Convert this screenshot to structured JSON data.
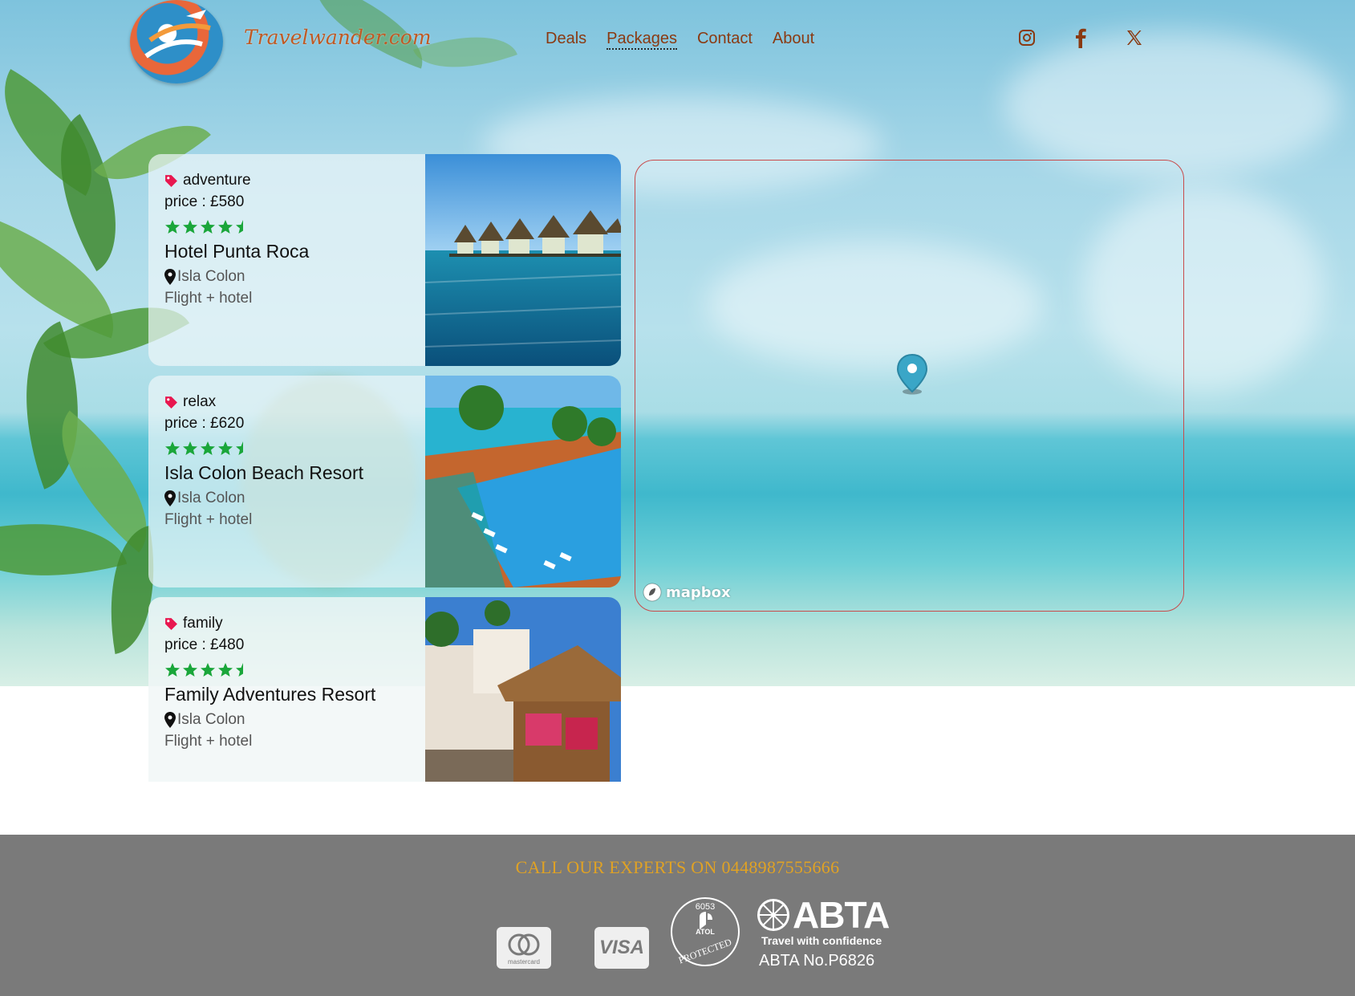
{
  "header": {
    "brand": "Travelwander.com",
    "nav": [
      "Deals",
      "Packages",
      "Contact",
      "About"
    ],
    "active_nav": "Packages",
    "social": [
      "instagram-icon",
      "facebook-icon",
      "x-icon"
    ]
  },
  "cards": [
    {
      "tag": "adventure",
      "price": "price : £580",
      "rating": 4.5,
      "title": "Hotel Punta Roca",
      "location": "Isla Colon",
      "type": "Flight + hotel"
    },
    {
      "tag": "relax",
      "price": "price : £620",
      "rating": 4.5,
      "title": "Isla Colon Beach Resort",
      "location": "Isla Colon",
      "type": "Flight + hotel"
    },
    {
      "tag": "family",
      "price": "price : £480",
      "rating": 4.5,
      "title": "Family Adventures Resort",
      "location": "Isla Colon",
      "type": "Flight + hotel"
    }
  ],
  "map": {
    "attribution": "mapbox"
  },
  "footer": {
    "call": "CALL OUR EXPERTS ON 0448987555666",
    "mastercard": "mastercard",
    "visa": "VISA",
    "atol_number": "6053",
    "atol_word": "ATOL",
    "atol_protected": "PROTECTED",
    "abta": "ABTA",
    "abta_tagline": "Travel with confidence",
    "abta_no": "ABTA No.P6826"
  },
  "colors": {
    "brand": "#c05a24",
    "nav": "#8a3a12",
    "tag": "#e8174f",
    "stars": "#1aa63a",
    "footer_bg": "#7a7a7a",
    "call_text": "#e0a224",
    "map_border": "#c84b4b"
  }
}
